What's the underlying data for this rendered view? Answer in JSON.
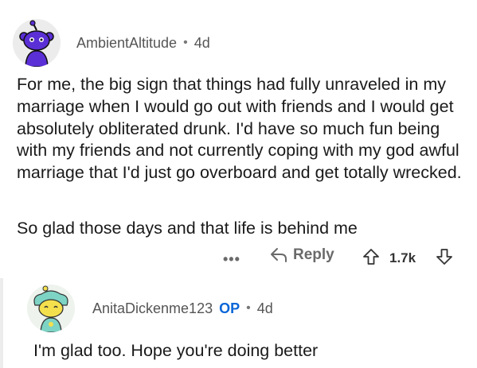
{
  "comment_1": {
    "username": "AmbientAltitude",
    "separator": "•",
    "age": "4d",
    "paragraphs": [
      "For me, the big sign that things had fully unraveled in my marriage when I would go out with friends and I would get absolutely obliterated drunk. I'd have so much fun being with my friends and not currently coping with my god awful marriage that I'd just go overboard and get totally wrecked.",
      "So glad those days and that life is behind me"
    ],
    "actions": {
      "more_label": "•••",
      "reply_label": "Reply",
      "score": "1.7k"
    }
  },
  "comment_2": {
    "username": "AnitaDickenme123",
    "op_badge": "OP",
    "separator": "•",
    "age": "4d",
    "body": "I'm glad too. Hope you're doing better"
  },
  "icons": {
    "avatar_1": "snoo-avatar-purple",
    "avatar_2": "snoo-avatar-teal",
    "reply": "reply-arrow-icon",
    "upvote": "upvote-arrow-icon",
    "downvote": "downvote-arrow-icon",
    "more": "more-options-icon"
  },
  "colors": {
    "op_badge": "#0a66d8",
    "avatar_1_primary": "#5b2fd6",
    "avatar_2_primary": "#7dd3c4",
    "text": "#1a1a1b",
    "meta_text": "#555555"
  }
}
